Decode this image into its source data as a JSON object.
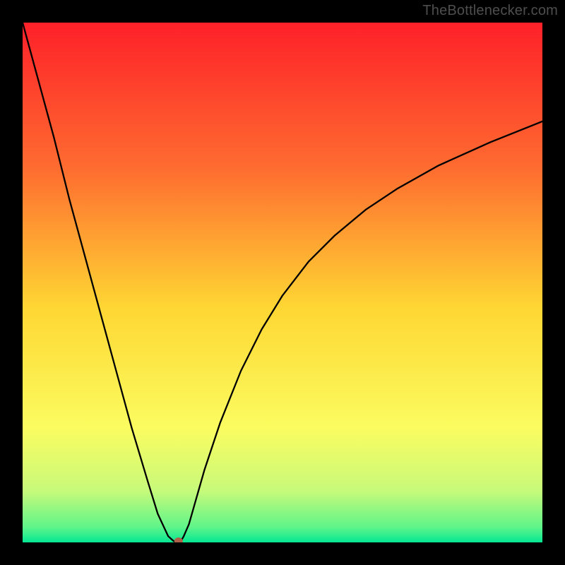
{
  "watermark": "TheBottlenecker.com",
  "colors": {
    "frame": "#000000",
    "line": "#000000",
    "marker": "#b06048",
    "gradient_stops": [
      {
        "pct": 0,
        "color": "#fe2029"
      },
      {
        "pct": 28,
        "color": "#fe6c30"
      },
      {
        "pct": 55,
        "color": "#fed733"
      },
      {
        "pct": 78,
        "color": "#fbfc60"
      },
      {
        "pct": 90,
        "color": "#c8fa7a"
      },
      {
        "pct": 97,
        "color": "#60f589"
      },
      {
        "pct": 100,
        "color": "#06e793"
      }
    ]
  },
  "chart_data": {
    "type": "line",
    "title": "",
    "xlabel": "",
    "ylabel": "",
    "xlim": [
      0,
      100
    ],
    "ylim": [
      0,
      100
    ],
    "grid": false,
    "series": [
      {
        "name": "bottleneck-curve",
        "x": [
          0,
          3,
          6,
          9,
          12,
          15,
          18,
          21,
          24,
          26,
          28,
          29,
          29.5,
          30,
          30.5,
          31,
          32,
          33,
          35,
          38,
          42,
          46,
          50,
          55,
          60,
          66,
          72,
          80,
          90,
          100
        ],
        "y": [
          100,
          89,
          78,
          66,
          55,
          44,
          33,
          22,
          12,
          5.5,
          1.2,
          0.3,
          0,
          0,
          0.3,
          1.2,
          3.5,
          7,
          14,
          23,
          33,
          41,
          47.5,
          54,
          59,
          64,
          68,
          72.5,
          77,
          81
        ]
      }
    ],
    "marker": {
      "x": 30,
      "y": 0,
      "name": "optimum-point"
    }
  }
}
